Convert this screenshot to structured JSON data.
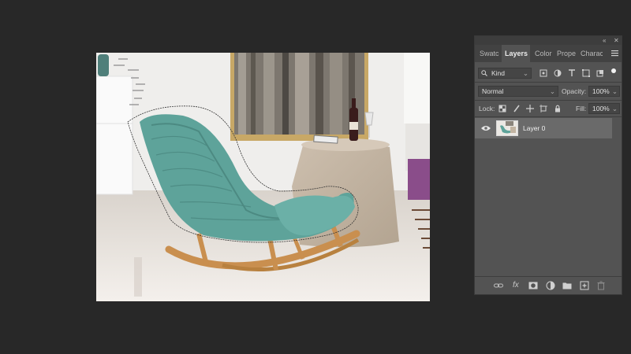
{
  "panel": {
    "tabs": [
      {
        "label": "Swatc"
      },
      {
        "label": "Layers"
      },
      {
        "label": "Color"
      },
      {
        "label": "Prope"
      },
      {
        "label": "Charac"
      }
    ],
    "filter": {
      "value": "Kind"
    },
    "blend_mode": {
      "value": "Normal"
    },
    "opacity": {
      "label": "Opacity:",
      "value": "100%"
    },
    "lock": {
      "label": "Lock:"
    },
    "fill": {
      "label": "Fill:",
      "value": "100%"
    },
    "layers": [
      {
        "name": "Layer 0",
        "visible": true
      }
    ],
    "topbar": {
      "collapse": "«",
      "close": "✕"
    }
  },
  "colors": {
    "background": "#282828",
    "panel": "#535353",
    "selected_layer": "#6a6a6a",
    "chair_fabric": "#5ea39a",
    "chair_wood": "#c98f4f"
  }
}
